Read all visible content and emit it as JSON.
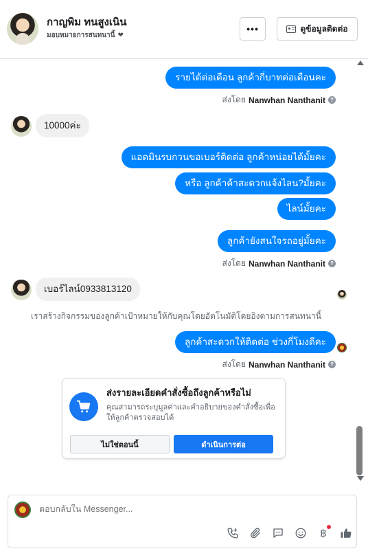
{
  "header": {
    "contact_name": "กาญพิม ทนสูงเนิน",
    "assign_label": "มอบหมายการสนทนานี้",
    "more_label": "•••",
    "contact_info_label": "ดูข้อมูลติดต่อ"
  },
  "messages": [
    {
      "dir": "out",
      "text": "รายได้ต่อเดือน ลูกค้ากี่บาทต่อเดือนคะ"
    },
    {
      "dir": "meta",
      "prefix": "ส่งโดย",
      "sender": "Nanwhan Nanthanit"
    },
    {
      "dir": "in",
      "text": "10000ค่ะ"
    },
    {
      "dir": "out",
      "text": "แอดมินรบกวนขอเบอร์ติดต่อ ลูกค้าหน่อยได้มั้ยคะ"
    },
    {
      "dir": "out",
      "text": "หรือ ลูกค้าค้าสะดวกแจ้งไลน?มั้ยคะ"
    },
    {
      "dir": "out",
      "text": "ไลน์มั้ยคะ"
    },
    {
      "dir": "out",
      "text": "ลูกค้ายังสนใจรถอยู่มั้ยคะ"
    },
    {
      "dir": "meta",
      "prefix": "ส่งโดย",
      "sender": "Nanwhan Nanthanit"
    },
    {
      "dir": "in",
      "text": "เบอร์ไลน์0933813120"
    },
    {
      "dir": "system",
      "text": "เราสร้างกิจกรรมของลูกค้าเป้าหมายให้กับคุณโดยอัตโนมัติโดยอิงตามการสนทนานี้"
    },
    {
      "dir": "out",
      "text": "ลูกค้าสะดวกให้ติดต่อ ช่วงกี่โมงดีคะ"
    },
    {
      "dir": "meta",
      "prefix": "ส่งโดย",
      "sender": "Nanwhan Nanthanit"
    }
  ],
  "help_icon": "?",
  "order_prompt": {
    "title": "ส่งรายละเอียดคำสั่งซื้อถึงลูกค้าหรือไม่",
    "description": "คุณสามารถระบุมูลค่าและคำอธิบายของคำสั่งซื้อเพื่อให้ลูกค้าตรวจสอบได้",
    "decline_label": "ไม่ใช่ตอนนี้",
    "continue_label": "ดำเนินการต่อ",
    "icon": "cart-icon"
  },
  "composer": {
    "placeholder": "ตอบกลับใน Messenger...",
    "baht_symbol": "฿",
    "icons": [
      "call-icon",
      "attachment-icon",
      "saved-reply-icon",
      "emoji-icon",
      "baht-icon",
      "like-icon"
    ]
  },
  "colors": {
    "outgoing_bubble": "#0084ff",
    "incoming_bubble": "#f0f0f0",
    "primary_button": "#1877f2",
    "notification_dot": "#f02849"
  }
}
